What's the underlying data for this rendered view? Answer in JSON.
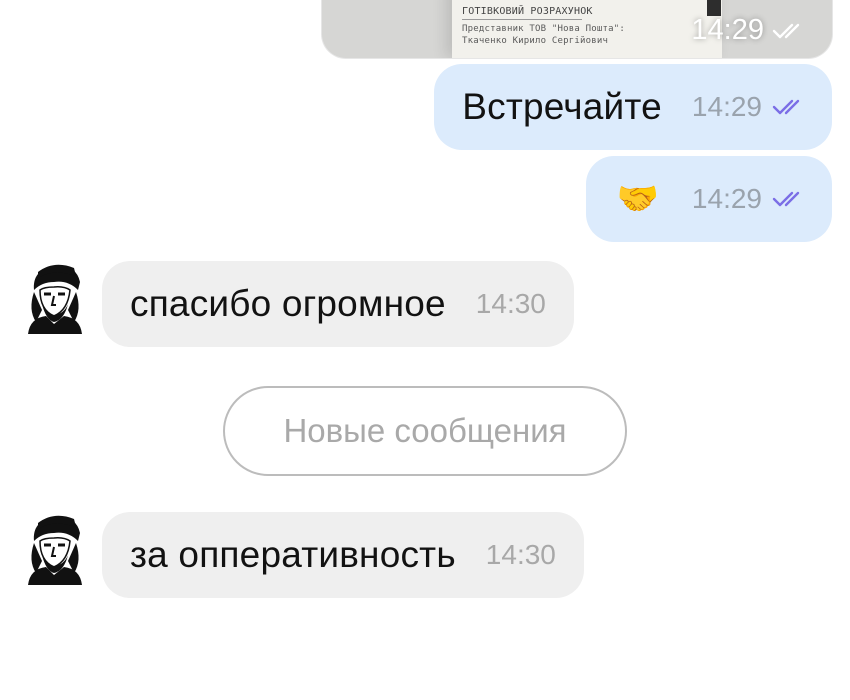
{
  "photo_message": {
    "receipt_line_1": "ГОТІВКОВИЙ РОЗРАХУНОК",
    "receipt_line_2": "Представник ТОВ \"Нова Пошта\":",
    "receipt_line_3": "Ткаченко Кирило Сергійович",
    "time": "14:29",
    "status_icon": "double-check-icon"
  },
  "messages": [
    {
      "direction": "out",
      "text": "Встречайте",
      "time": "14:29",
      "status_icon": "double-check-icon"
    },
    {
      "direction": "out",
      "emoji": "🤝",
      "time": "14:29",
      "status_icon": "double-check-icon"
    },
    {
      "direction": "in",
      "text": "спасибо огромное",
      "time": "14:30",
      "avatar_icon": "portrait-avatar"
    },
    {
      "direction": "in",
      "text": "за опперативность",
      "time": "14:30",
      "avatar_icon": "portrait-avatar"
    }
  ],
  "divider": {
    "label": "Новые сообщения"
  },
  "colors": {
    "outgoing_bubble": "#dcebfc",
    "incoming_bubble": "#efefef",
    "read_check": "#7b6ee6",
    "divider_border": "#bcbcbc"
  }
}
